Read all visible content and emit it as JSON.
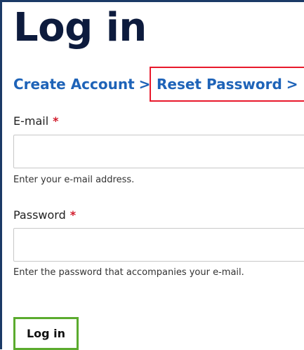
{
  "page": {
    "title": "Log in"
  },
  "links": {
    "create_account": "Create Account",
    "reset_password": "Reset Password",
    "chevron": ">"
  },
  "form": {
    "email": {
      "label": "E-mail",
      "required_marker": "*",
      "value": "",
      "help": "Enter your e-mail address."
    },
    "password": {
      "label": "Password",
      "required_marker": "*",
      "value": "",
      "help": "Enter the password that accompanies your e-mail."
    },
    "submit_label": "Log in"
  },
  "colors": {
    "title": "#0d1b3d",
    "link": "#1e63b8",
    "required": "#d11a2a",
    "reset_highlight_border": "#e8192c",
    "submit_highlight_border": "#5bab2e",
    "frame_border": "#1b3a66"
  }
}
